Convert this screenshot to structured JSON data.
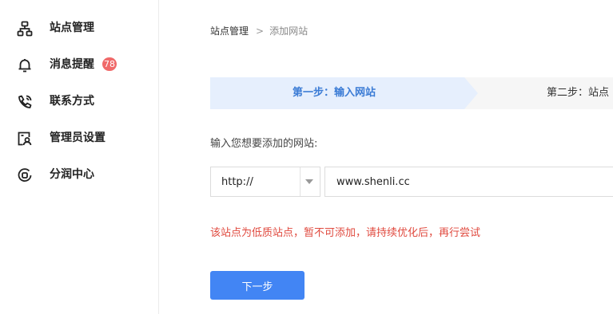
{
  "sidebar": {
    "items": [
      {
        "label": "站点管理",
        "icon": "sitemap-icon"
      },
      {
        "label": "消息提醒",
        "icon": "bell-icon",
        "badge": "78"
      },
      {
        "label": "联系方式",
        "icon": "phone-icon"
      },
      {
        "label": "管理员设置",
        "icon": "admin-icon"
      },
      {
        "label": "分润中心",
        "icon": "profit-icon"
      }
    ]
  },
  "breadcrumb": {
    "root": "站点管理",
    "separator": ">",
    "current": "添加网站"
  },
  "steps": {
    "active": "第一步：输入网站",
    "next": "第二步：站点"
  },
  "form": {
    "label": "输入您想要添加的网站:",
    "protocol": "http://",
    "domain": "www.shenli.cc",
    "error": "该站点为低质站点，暂不可添加，请持续优化后，再行尝试"
  },
  "actions": {
    "next_label": "下一步"
  },
  "colors": {
    "accent": "#4285f4",
    "step_active_bg": "#e6effd",
    "step_active_text": "#3a7bd5",
    "error": "#e04a3f",
    "badge": "#f06a6a"
  }
}
